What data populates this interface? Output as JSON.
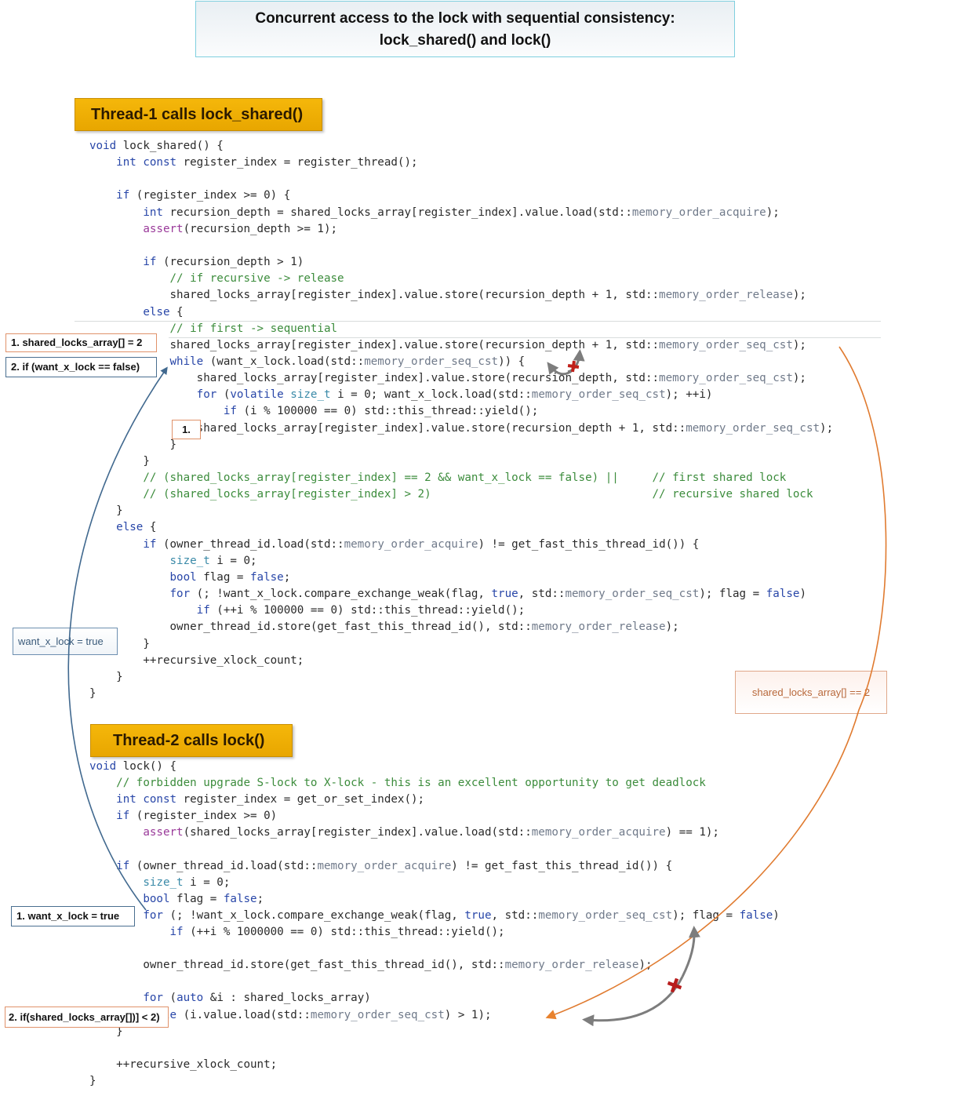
{
  "title": {
    "line1": "Concurrent access to the lock with sequential consistency:",
    "line2": "lock_shared()  and  lock()"
  },
  "thread1": {
    "banner": "Thread-1 calls  lock_shared()",
    "code": [
      [
        {
          "t": "void",
          "c": "kw"
        },
        {
          "t": " lock_shared() {"
        }
      ],
      [
        {
          "t": "    "
        },
        {
          "t": "int",
          "c": "kw"
        },
        {
          "t": " "
        },
        {
          "t": "const",
          "c": "kw"
        },
        {
          "t": " register_index = register_thread();"
        }
      ],
      [],
      [
        {
          "t": "    "
        },
        {
          "t": "if",
          "c": "kw"
        },
        {
          "t": " (register_index >= 0) {"
        }
      ],
      [
        {
          "t": "        "
        },
        {
          "t": "int",
          "c": "kw"
        },
        {
          "t": " recursion_depth = shared_locks_array[register_index].value.load(std::"
        },
        {
          "t": "memory_order_acquire",
          "c": "mo"
        },
        {
          "t": ");"
        }
      ],
      [
        {
          "t": "        "
        },
        {
          "t": "assert",
          "c": "fn"
        },
        {
          "t": "(recursion_depth >= 1);"
        }
      ],
      [],
      [
        {
          "t": "        "
        },
        {
          "t": "if",
          "c": "kw"
        },
        {
          "t": " (recursion_depth > 1)"
        }
      ],
      [
        {
          "t": "            "
        },
        {
          "t": "// if recursive -> release",
          "c": "cm"
        }
      ],
      [
        {
          "t": "            shared_locks_array[register_index].value.store(recursion_depth + 1, std::"
        },
        {
          "t": "memory_order_release",
          "c": "mo"
        },
        {
          "t": ");"
        }
      ],
      [
        {
          "t": "        "
        },
        {
          "t": "else",
          "c": "kw"
        },
        {
          "t": " {"
        }
      ],
      [
        {
          "t": "            "
        },
        {
          "t": "// if first -> sequential",
          "c": "cm"
        }
      ],
      [
        {
          "t": "            shared_locks_array[register_index].value.store(recursion_depth + 1, std::"
        },
        {
          "t": "memory_order_seq_cst",
          "c": "mo"
        },
        {
          "t": ");"
        }
      ],
      [
        {
          "t": "            "
        },
        {
          "t": "while",
          "c": "kw"
        },
        {
          "t": " (want_x_lock.load(std::"
        },
        {
          "t": "memory_order_seq_cst",
          "c": "mo"
        },
        {
          "t": ")) {"
        }
      ],
      [
        {
          "t": "                shared_locks_array[register_index].value.store(recursion_depth, std::"
        },
        {
          "t": "memory_order_seq_cst",
          "c": "mo"
        },
        {
          "t": ");"
        }
      ],
      [
        {
          "t": "                "
        },
        {
          "t": "for",
          "c": "kw"
        },
        {
          "t": " ("
        },
        {
          "t": "volatile",
          "c": "kw"
        },
        {
          "t": " "
        },
        {
          "t": "size_t",
          "c": "ty"
        },
        {
          "t": " i = 0; want_x_lock.load(std::"
        },
        {
          "t": "memory_order_seq_cst",
          "c": "mo"
        },
        {
          "t": "); ++i)"
        }
      ],
      [
        {
          "t": "                    "
        },
        {
          "t": "if",
          "c": "kw"
        },
        {
          "t": " (i % 100000 == 0) std::this_thread::yield();"
        }
      ],
      [
        {
          "t": "                shared_locks_array[register_index].value.store(recursion_depth + 1, std::"
        },
        {
          "t": "memory_order_seq_cst",
          "c": "mo"
        },
        {
          "t": ");"
        }
      ],
      [
        {
          "t": "            }"
        }
      ],
      [
        {
          "t": "        }"
        }
      ],
      [
        {
          "t": "        "
        },
        {
          "t": "// (shared_locks_array[register_index] == 2 && want_x_lock == false) ||     // first shared lock",
          "c": "cm"
        }
      ],
      [
        {
          "t": "        "
        },
        {
          "t": "// (shared_locks_array[register_index] > 2)                                 // recursive shared lock",
          "c": "cm"
        }
      ],
      [
        {
          "t": "    }"
        }
      ],
      [
        {
          "t": "    "
        },
        {
          "t": "else",
          "c": "kw"
        },
        {
          "t": " {"
        }
      ],
      [
        {
          "t": "        "
        },
        {
          "t": "if",
          "c": "kw"
        },
        {
          "t": " (owner_thread_id.load(std::"
        },
        {
          "t": "memory_order_acquire",
          "c": "mo"
        },
        {
          "t": ") != get_fast_this_thread_id()) {"
        }
      ],
      [
        {
          "t": "            "
        },
        {
          "t": "size_t",
          "c": "ty"
        },
        {
          "t": " i = 0;"
        }
      ],
      [
        {
          "t": "            "
        },
        {
          "t": "bool",
          "c": "kw"
        },
        {
          "t": " flag = "
        },
        {
          "t": "false",
          "c": "kw"
        },
        {
          "t": ";"
        }
      ],
      [
        {
          "t": "            "
        },
        {
          "t": "for",
          "c": "kw"
        },
        {
          "t": " (; !want_x_lock.compare_exchange_weak(flag, "
        },
        {
          "t": "true",
          "c": "kw"
        },
        {
          "t": ", std::"
        },
        {
          "t": "memory_order_seq_cst",
          "c": "mo"
        },
        {
          "t": "); flag = "
        },
        {
          "t": "false",
          "c": "kw"
        },
        {
          "t": ")"
        }
      ],
      [
        {
          "t": "                "
        },
        {
          "t": "if",
          "c": "kw"
        },
        {
          "t": " (++i % 100000 == 0) std::this_thread::yield();"
        }
      ],
      [
        {
          "t": "            owner_thread_id.store(get_fast_this_thread_id(), std::"
        },
        {
          "t": "memory_order_release",
          "c": "mo"
        },
        {
          "t": ");"
        }
      ],
      [
        {
          "t": "        }"
        }
      ],
      [
        {
          "t": "        ++recursive_xlock_count;"
        }
      ],
      [
        {
          "t": "    }"
        }
      ],
      [
        {
          "t": "}"
        }
      ]
    ]
  },
  "thread2": {
    "banner": "Thread-2 calls  lock()",
    "code": [
      [
        {
          "t": "void",
          "c": "kw"
        },
        {
          "t": " lock() {"
        }
      ],
      [
        {
          "t": "    "
        },
        {
          "t": "// forbidden upgrade S-lock to X-lock - this is an excellent opportunity to get deadlock",
          "c": "cm"
        }
      ],
      [
        {
          "t": "    "
        },
        {
          "t": "int",
          "c": "kw"
        },
        {
          "t": " "
        },
        {
          "t": "const",
          "c": "kw"
        },
        {
          "t": " register_index = get_or_set_index();"
        }
      ],
      [
        {
          "t": "    "
        },
        {
          "t": "if",
          "c": "kw"
        },
        {
          "t": " (register_index >= 0)"
        }
      ],
      [
        {
          "t": "        "
        },
        {
          "t": "assert",
          "c": "fn"
        },
        {
          "t": "(shared_locks_array[register_index].value.load(std::"
        },
        {
          "t": "memory_order_acquire",
          "c": "mo"
        },
        {
          "t": ") == 1);"
        }
      ],
      [],
      [
        {
          "t": "    "
        },
        {
          "t": "if",
          "c": "kw"
        },
        {
          "t": " (owner_thread_id.load(std::"
        },
        {
          "t": "memory_order_acquire",
          "c": "mo"
        },
        {
          "t": ") != get_fast_this_thread_id()) {"
        }
      ],
      [
        {
          "t": "        "
        },
        {
          "t": "size_t",
          "c": "ty"
        },
        {
          "t": " i = 0;"
        }
      ],
      [
        {
          "t": "        "
        },
        {
          "t": "bool",
          "c": "kw"
        },
        {
          "t": " flag = "
        },
        {
          "t": "false",
          "c": "kw"
        },
        {
          "t": ";"
        }
      ],
      [
        {
          "t": "        "
        },
        {
          "t": "for",
          "c": "kw"
        },
        {
          "t": " (; !want_x_lock.compare_exchange_weak(flag, "
        },
        {
          "t": "true",
          "c": "kw"
        },
        {
          "t": ", std::"
        },
        {
          "t": "memory_order_seq_cst",
          "c": "mo"
        },
        {
          "t": "); flag = "
        },
        {
          "t": "false",
          "c": "kw"
        },
        {
          "t": ")"
        }
      ],
      [
        {
          "t": "            "
        },
        {
          "t": "if",
          "c": "kw"
        },
        {
          "t": " (++i % 1000000 == 0) std::this_thread::yield();"
        }
      ],
      [],
      [
        {
          "t": "        owner_thread_id.store(get_fast_this_thread_id(), std::"
        },
        {
          "t": "memory_order_release",
          "c": "mo"
        },
        {
          "t": ");"
        }
      ],
      [],
      [
        {
          "t": "        "
        },
        {
          "t": "for",
          "c": "kw"
        },
        {
          "t": " ("
        },
        {
          "t": "auto",
          "c": "kw"
        },
        {
          "t": " &i : shared_locks_array)"
        }
      ],
      [
        {
          "t": "        "
        },
        {
          "t": "while",
          "c": "kw"
        },
        {
          "t": " (i.value.load(std::"
        },
        {
          "t": "memory_order_seq_cst",
          "c": "mo"
        },
        {
          "t": ") > 1);"
        }
      ],
      [
        {
          "t": "    }"
        }
      ],
      [],
      [
        {
          "t": "    ++recursive_xlock_count;"
        }
      ],
      [
        {
          "t": "}"
        }
      ]
    ]
  },
  "notes": {
    "t1_step1": "1.  shared_locks_array[] = 2",
    "t1_step2": "2.  if (want_x_lock == false)",
    "t1_inline_step1": "1.",
    "want_x_lock_true": "want_x_lock = true",
    "shared_eq_2": "shared_locks_array[] == 2",
    "t2_step1": "1.  want_x_lock = true",
    "t2_step2": "2. if(shared_locks_array[])] < 2)"
  },
  "colors": {
    "banner": "#f0b000",
    "blue_arrow": "#41698f",
    "orange_arrow": "#e07b30",
    "gray_arrow": "#7d7d7d",
    "cross": "#c0201a"
  }
}
